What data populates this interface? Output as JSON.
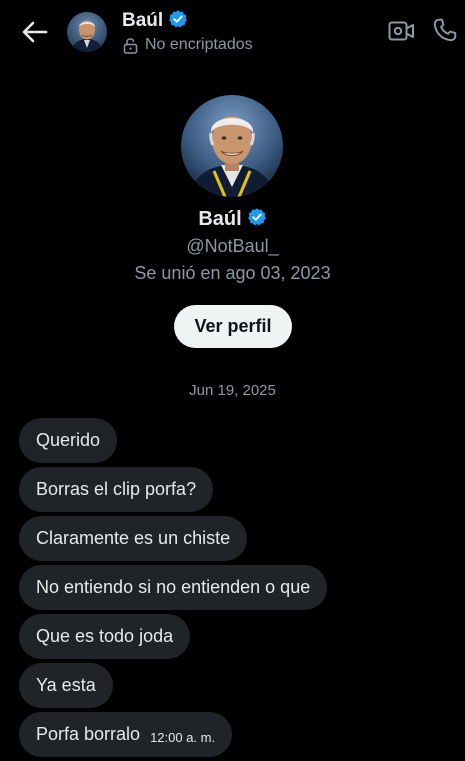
{
  "header": {
    "name": "Baúl",
    "encryption_status": "No encriptados",
    "icons": {
      "back": "arrow-left-icon",
      "verified": "verified-badge-icon",
      "lock": "lock-open-icon",
      "video": "video-call-icon",
      "phone": "phone-call-icon"
    }
  },
  "profile": {
    "name": "Baúl",
    "handle": "@NotBaul_",
    "joined": "Se unió en ago 03, 2023",
    "view_profile_label": "Ver perfil"
  },
  "conversation": {
    "date_separator": "Jun 19, 2025",
    "messages": [
      {
        "text": "Querido"
      },
      {
        "text": "Borras el clip porfa?"
      },
      {
        "text": "Claramente es un chiste"
      },
      {
        "text": "No entiendo si no entienden o que"
      },
      {
        "text": "Que es todo joda"
      },
      {
        "text": "Ya esta"
      },
      {
        "text": "Porfa borralo",
        "time": "12:00 a. m."
      }
    ]
  },
  "colors": {
    "background": "#000000",
    "bubble": "#202327",
    "verified": "#1d9bf0",
    "secondary_text": "#8b98a5",
    "button_bg": "#eff3f4"
  }
}
